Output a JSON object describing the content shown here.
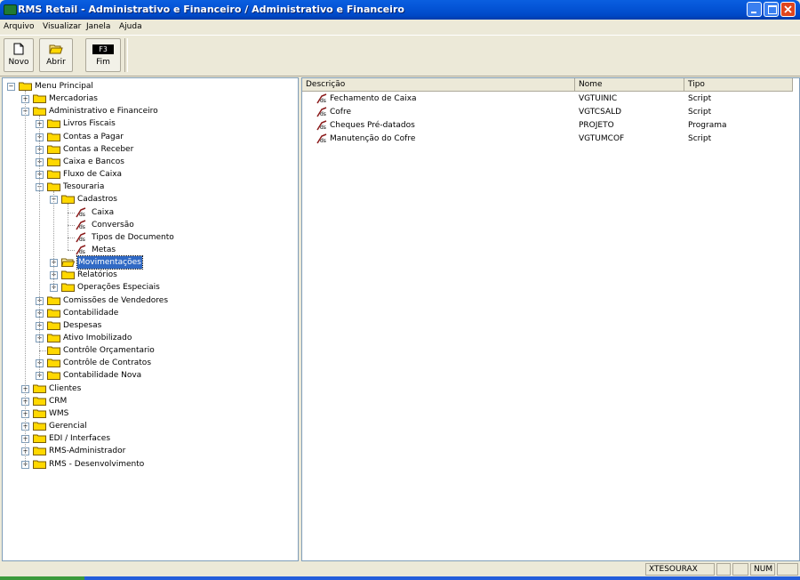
{
  "window": {
    "title": "RMS Retail - Administrativo e Financeiro / Administrativo e Financeiro"
  },
  "menu": [
    {
      "label": "Arquivo"
    },
    {
      "label": "Visualizar"
    },
    {
      "label": "Janela"
    },
    {
      "label": "Ajuda"
    }
  ],
  "toolbar": {
    "novo_label": "Novo",
    "abrir_label": "Abrir",
    "fim_label": "Fim",
    "fim_key": "F3"
  },
  "tree": [
    {
      "label": "Menu Principal",
      "level": 0,
      "exp": "minus",
      "icon": "folder"
    },
    {
      "label": "Mercadorias",
      "level": 1,
      "exp": "plus",
      "icon": "folder"
    },
    {
      "label": "Administrativo e Financeiro",
      "level": 1,
      "exp": "minus",
      "icon": "folder"
    },
    {
      "label": "Livros Fiscais",
      "level": 2,
      "exp": "plus",
      "icon": "folder"
    },
    {
      "label": "Contas a Pagar",
      "level": 2,
      "exp": "plus",
      "icon": "folder"
    },
    {
      "label": "Contas a Receber",
      "level": 2,
      "exp": "plus",
      "icon": "folder"
    },
    {
      "label": "Caixa e Bancos",
      "level": 2,
      "exp": "plus",
      "icon": "folder"
    },
    {
      "label": "Fluxo de Caixa",
      "level": 2,
      "exp": "plus",
      "icon": "folder"
    },
    {
      "label": "Tesouraria",
      "level": 2,
      "exp": "minus",
      "icon": "folder"
    },
    {
      "label": "Cadastros",
      "level": 3,
      "exp": "minus",
      "icon": "folder"
    },
    {
      "label": "Caixa",
      "level": 4,
      "exp": "none",
      "icon": "script"
    },
    {
      "label": "Conversão",
      "level": 4,
      "exp": "none",
      "icon": "script"
    },
    {
      "label": "Tipos de Documento",
      "level": 4,
      "exp": "none",
      "icon": "script"
    },
    {
      "label": "Metas",
      "level": 4,
      "exp": "none",
      "icon": "script"
    },
    {
      "label": "Movimentações",
      "level": 3,
      "exp": "plus",
      "icon": "folder-open",
      "selected": true
    },
    {
      "label": "Relatórios",
      "level": 3,
      "exp": "plus",
      "icon": "folder"
    },
    {
      "label": "Operações Especiais",
      "level": 3,
      "exp": "plus",
      "icon": "folder"
    },
    {
      "label": "Comissões de Vendedores",
      "level": 2,
      "exp": "plus",
      "icon": "folder"
    },
    {
      "label": "Contabilidade",
      "level": 2,
      "exp": "plus",
      "icon": "folder"
    },
    {
      "label": "Despesas",
      "level": 2,
      "exp": "plus",
      "icon": "folder"
    },
    {
      "label": "Ativo Imobilizado",
      "level": 2,
      "exp": "plus",
      "icon": "folder"
    },
    {
      "label": "Contrôle Orçamentario",
      "level": 2,
      "exp": "none",
      "icon": "folder"
    },
    {
      "label": "Contrôle de Contratos",
      "level": 2,
      "exp": "plus",
      "icon": "folder"
    },
    {
      "label": "Contabilidade Nova",
      "level": 2,
      "exp": "plus",
      "icon": "folder"
    },
    {
      "label": "Clientes",
      "level": 1,
      "exp": "plus",
      "icon": "folder"
    },
    {
      "label": "CRM",
      "level": 1,
      "exp": "plus",
      "icon": "folder"
    },
    {
      "label": "WMS",
      "level": 1,
      "exp": "plus",
      "icon": "folder"
    },
    {
      "label": "Gerencial",
      "level": 1,
      "exp": "plus",
      "icon": "folder"
    },
    {
      "label": "EDI / Interfaces",
      "level": 1,
      "exp": "plus",
      "icon": "folder"
    },
    {
      "label": "RMS-Administrador",
      "level": 1,
      "exp": "plus",
      "icon": "folder"
    },
    {
      "label": "RMS - Desenvolvimento",
      "level": 1,
      "exp": "plus",
      "icon": "folder"
    }
  ],
  "list": {
    "columns": [
      "Descrição",
      "Nome",
      "Tipo"
    ],
    "rows": [
      [
        "Fechamento de Caixa",
        "VGTUINIC",
        "Script"
      ],
      [
        "Cofre",
        "VGTCSALD",
        "Script"
      ],
      [
        "Cheques Pré-datados",
        "PROJETO",
        "Programa"
      ],
      [
        "Manutenção do Cofre",
        "VGTUMCOF",
        "Script"
      ]
    ]
  },
  "status": {
    "user": "XTESOURAX",
    "num": "NUM"
  },
  "colors": {
    "titlebar": "#0454d6",
    "selection": "#316ac5",
    "folder": "#ffd800"
  }
}
